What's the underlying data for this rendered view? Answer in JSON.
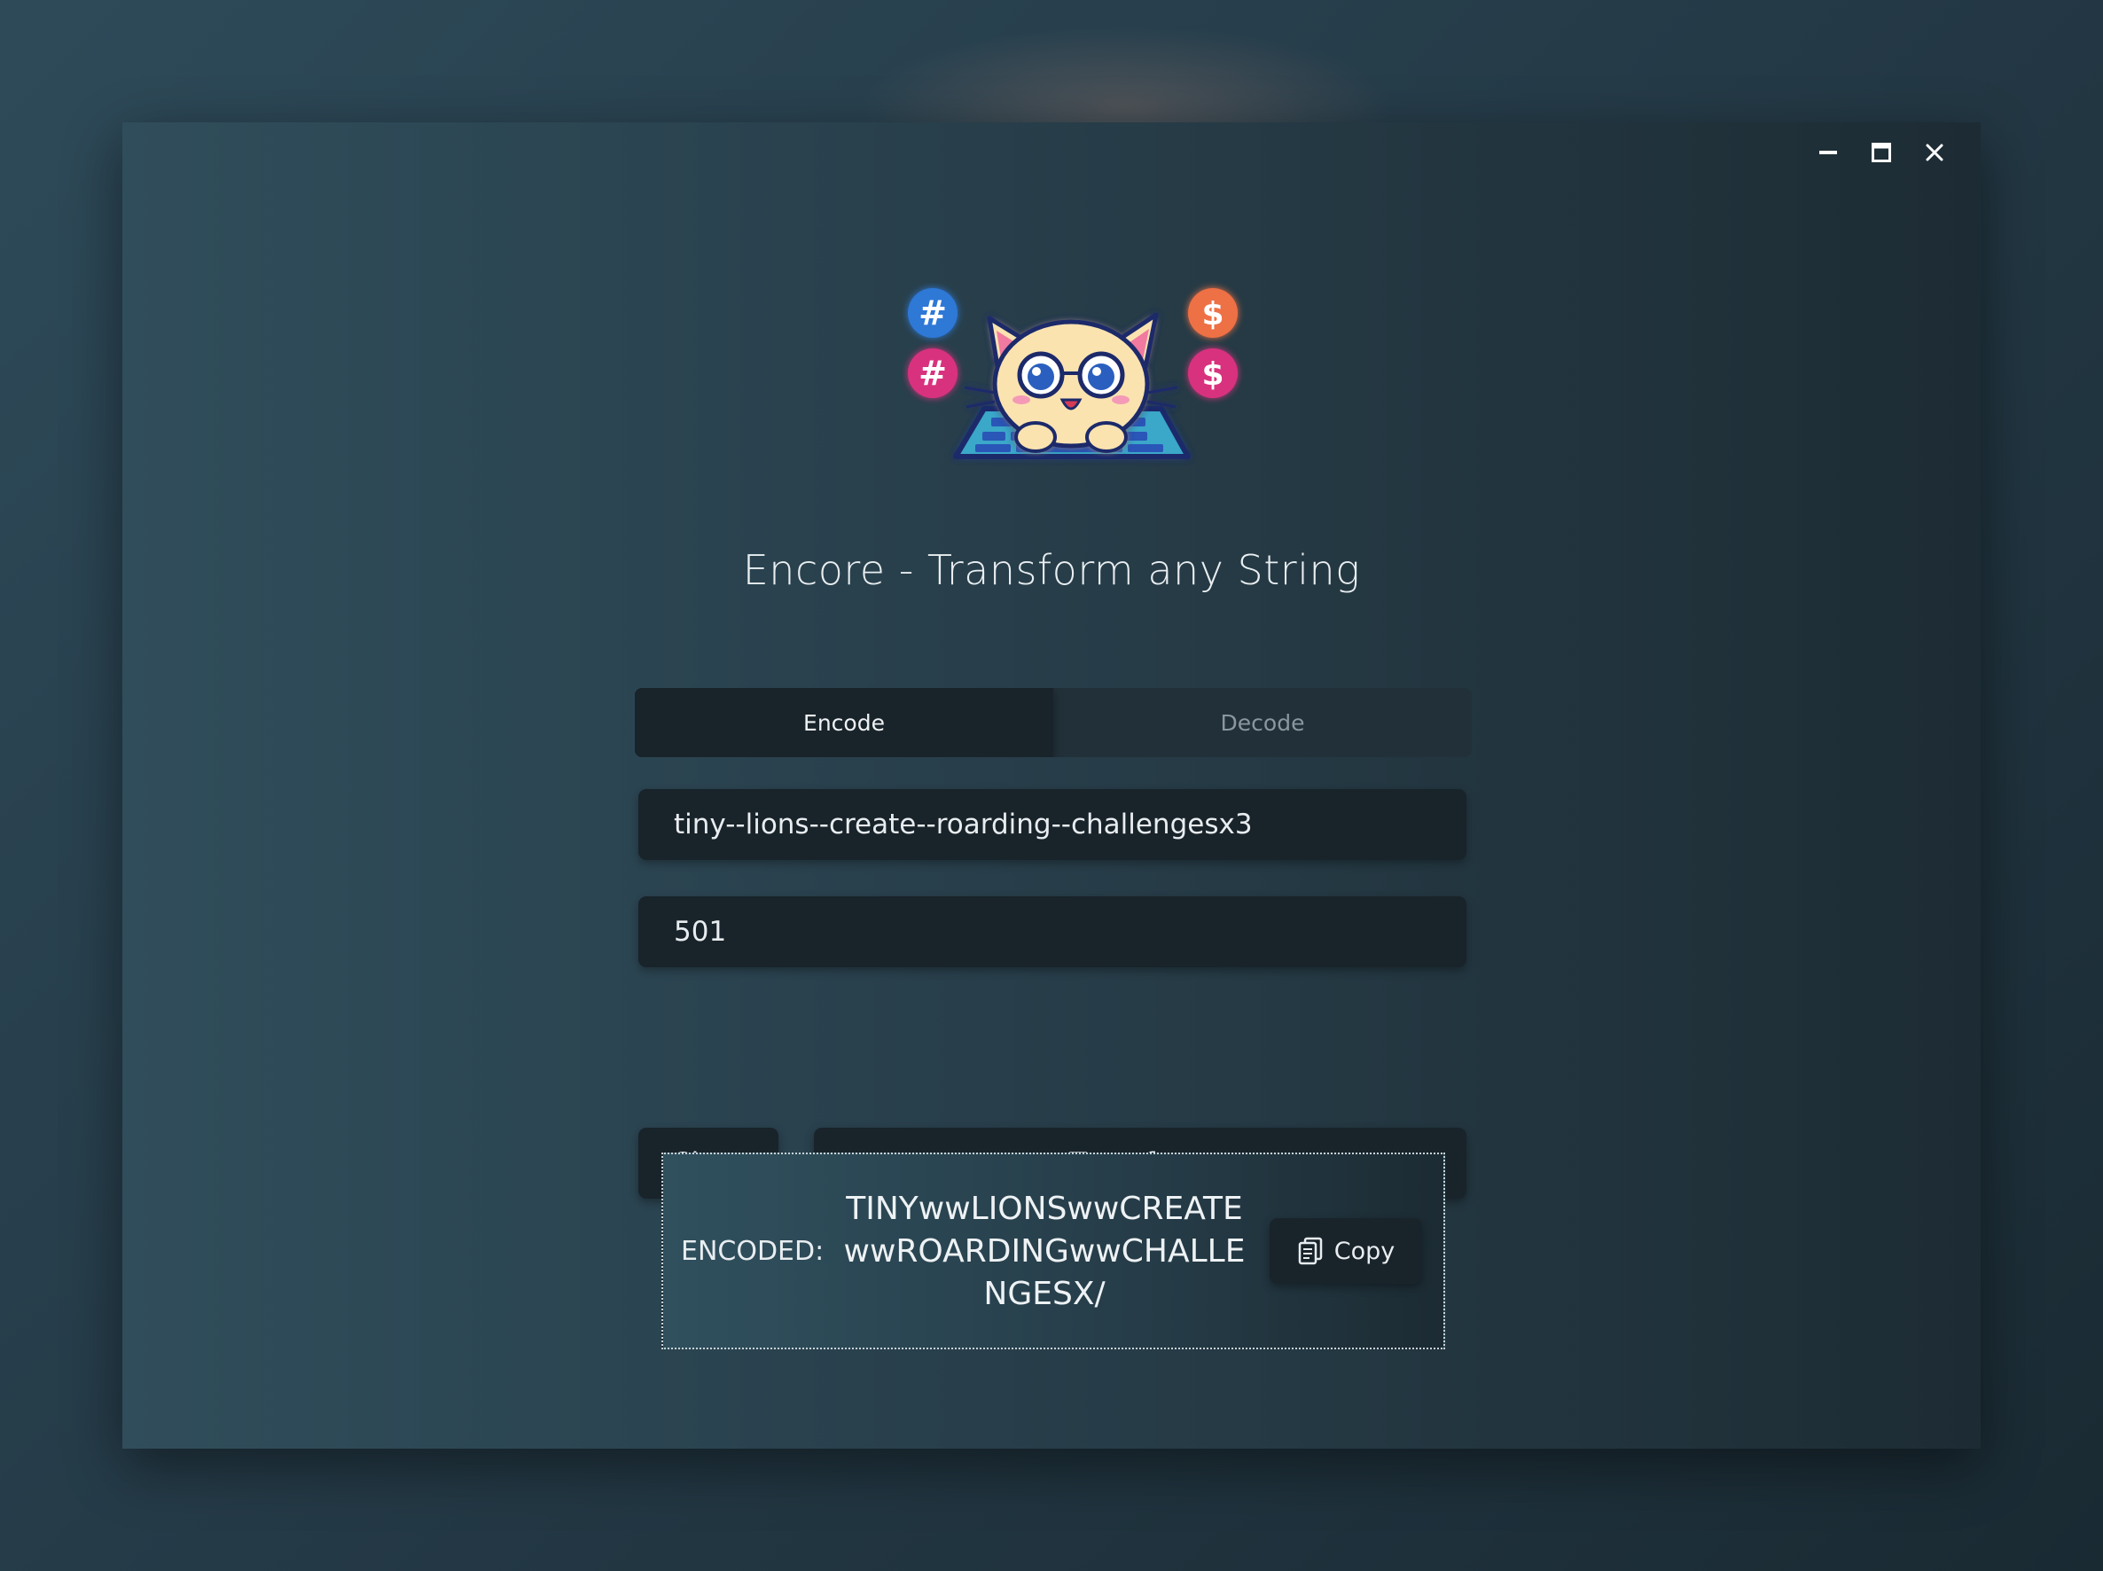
{
  "window": {
    "controls": [
      "minimize",
      "maximize",
      "close"
    ]
  },
  "header": {
    "title": "Encore - Transform any String"
  },
  "tabs": [
    {
      "label": "Encode",
      "active": true
    },
    {
      "label": "Decode",
      "active": false
    }
  ],
  "form": {
    "input_value": "tiny--lions--create--roarding--challengesx3",
    "key_value": "501"
  },
  "buttons": {
    "clear_label": "Clear",
    "transform_label": "Transform",
    "copy_label": "Copy"
  },
  "result": {
    "label": "ENCODED:",
    "value": "TINYwwLIONSwwCREATEwwROARDINGwwCHALLENGESX/"
  },
  "colors": {
    "background": "#283f4b",
    "surface": "#19232a",
    "text": "#eef2f4",
    "muted_text": "#8a979f"
  },
  "icons": [
    "minimize-icon",
    "maximize-icon",
    "close-icon",
    "copy-icon",
    "cat-logo"
  ]
}
